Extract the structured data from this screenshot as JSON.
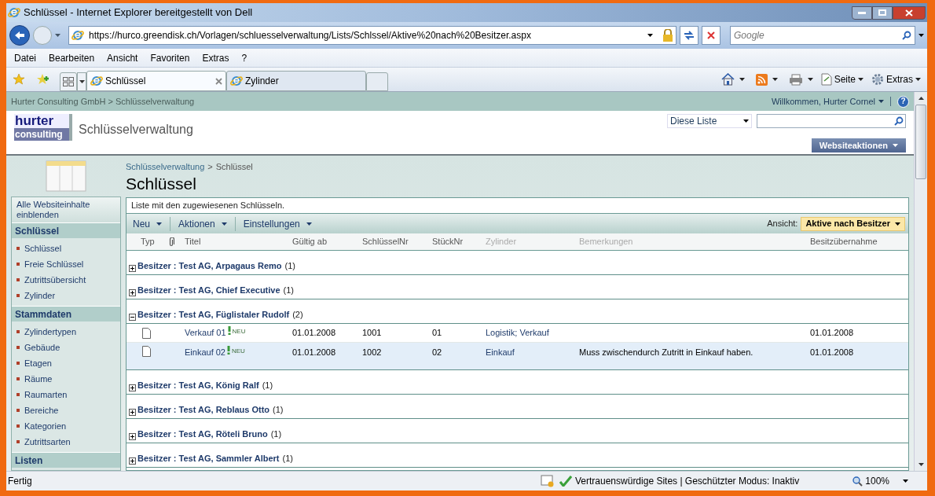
{
  "window": {
    "title": "Schlüssel - Internet Explorer bereitgestellt von Dell"
  },
  "address_bar": {
    "url": "https://hurco.greendisk.ch/Vorlagen/schluesselverwaltung/Lists/Schlssel/Aktive%20nach%20Besitzer.aspx",
    "search_placeholder": "Google"
  },
  "menu": [
    "Datei",
    "Bearbeiten",
    "Ansicht",
    "Favoriten",
    "Extras",
    "?"
  ],
  "tabs": [
    {
      "label": "Schlüssel",
      "selected": true
    },
    {
      "label": "Zylinder",
      "selected": false
    }
  ],
  "command_bar": [
    "Seite",
    "Extras"
  ],
  "site": {
    "breadcrumb": "Hurter Consulting GmbH > Schlüsselverwaltung",
    "welcome": "Willkommen, Hurter Cornel",
    "logo_top": "hurter",
    "logo_bottom": "consulting",
    "title": "Schlüsselverwaltung",
    "search_scope": "Diese Liste",
    "site_actions": "Websiteaktionen",
    "help": "?"
  },
  "page": {
    "breadcrumb_link": "Schlüsselverwaltung",
    "breadcrumb_separator": ">",
    "breadcrumb_current": "Schlüssel",
    "title": "Schlüssel",
    "description": "Liste mit den zugewiesenen Schlüsseln."
  },
  "sidebar": {
    "view_all": "Alle Websiteinhalte einblenden",
    "sections": [
      {
        "title": "Schlüssel",
        "items": [
          "Schlüssel",
          "Freie Schlüssel",
          "Zutrittsübersicht",
          "Zylinder"
        ]
      },
      {
        "title": "Stammdaten",
        "items": [
          "Zylindertypen",
          "Gebäude",
          "Etagen",
          "Räume",
          "Raumarten",
          "Bereiche",
          "Kategorien",
          "Zutrittsarten"
        ]
      },
      {
        "title": "Listen"
      }
    ]
  },
  "toolbar": {
    "menus": [
      "Neu",
      "Aktionen",
      "Einstellungen"
    ],
    "view_label": "Ansicht:",
    "view": "Aktive nach Besitzer"
  },
  "table": {
    "columns": [
      {
        "kind": "text",
        "label": "Typ",
        "sortable": true
      },
      {
        "kind": "attachment",
        "sortable": true
      },
      {
        "kind": "text",
        "label": "Titel",
        "sortable": true
      },
      {
        "kind": "text",
        "label": "Gültig ab",
        "sortable": true
      },
      {
        "kind": "text",
        "label": "SchlüsselNr",
        "sortable": true
      },
      {
        "kind": "text",
        "label": "StückNr",
        "sortable": true
      },
      {
        "kind": "text",
        "label": "Zylinder",
        "sortable": false
      },
      {
        "kind": "text",
        "label": "Bemerkungen",
        "sortable": false
      },
      {
        "kind": "text",
        "label": "Besitzübernahme",
        "sortable": true
      }
    ],
    "groups": [
      {
        "label": "Besitzer : Test AG, Arpagaus Remo",
        "count": "(1)",
        "expanded": false
      },
      {
        "label": "Besitzer : Test AG, Chief Executive",
        "count": "(1)",
        "expanded": false
      },
      {
        "label": "Besitzer : Test AG, Füglistaler Rudolf",
        "count": "(2)",
        "expanded": true,
        "rows": [
          {
            "title": "Verkauf 01",
            "badge": "NEU",
            "valid_from": "01.01.2008",
            "key_no": "1001",
            "piece_no": "01",
            "cylinder": "Logistik; Verkauf",
            "handover": "01.01.2008",
            "selected": false
          },
          {
            "title": "Einkauf 02",
            "badge": "NEU",
            "valid_from": "01.01.2008",
            "key_no": "1002",
            "piece_no": "02",
            "cylinder": "Einkauf",
            "remarks": "Muss zwischendurch Zutritt in Einkauf haben.",
            "handover": "01.01.2008",
            "selected": true
          }
        ]
      },
      {
        "label": "Besitzer : Test AG, König Ralf",
        "count": "(1)",
        "expanded": false
      },
      {
        "label": "Besitzer : Test AG, Reblaus Otto",
        "count": "(1)",
        "expanded": false
      },
      {
        "label": "Besitzer : Test AG, Röteli Bruno",
        "count": "(1)",
        "expanded": false
      },
      {
        "label": "Besitzer : Test AG, Sammler Albert",
        "count": "(1)",
        "expanded": false
      }
    ]
  },
  "status_bar": {
    "text": "Fertig",
    "zone": "Vertrauenswürdige Sites | Geschützter Modus: Inaktiv",
    "zoom": "100%"
  }
}
